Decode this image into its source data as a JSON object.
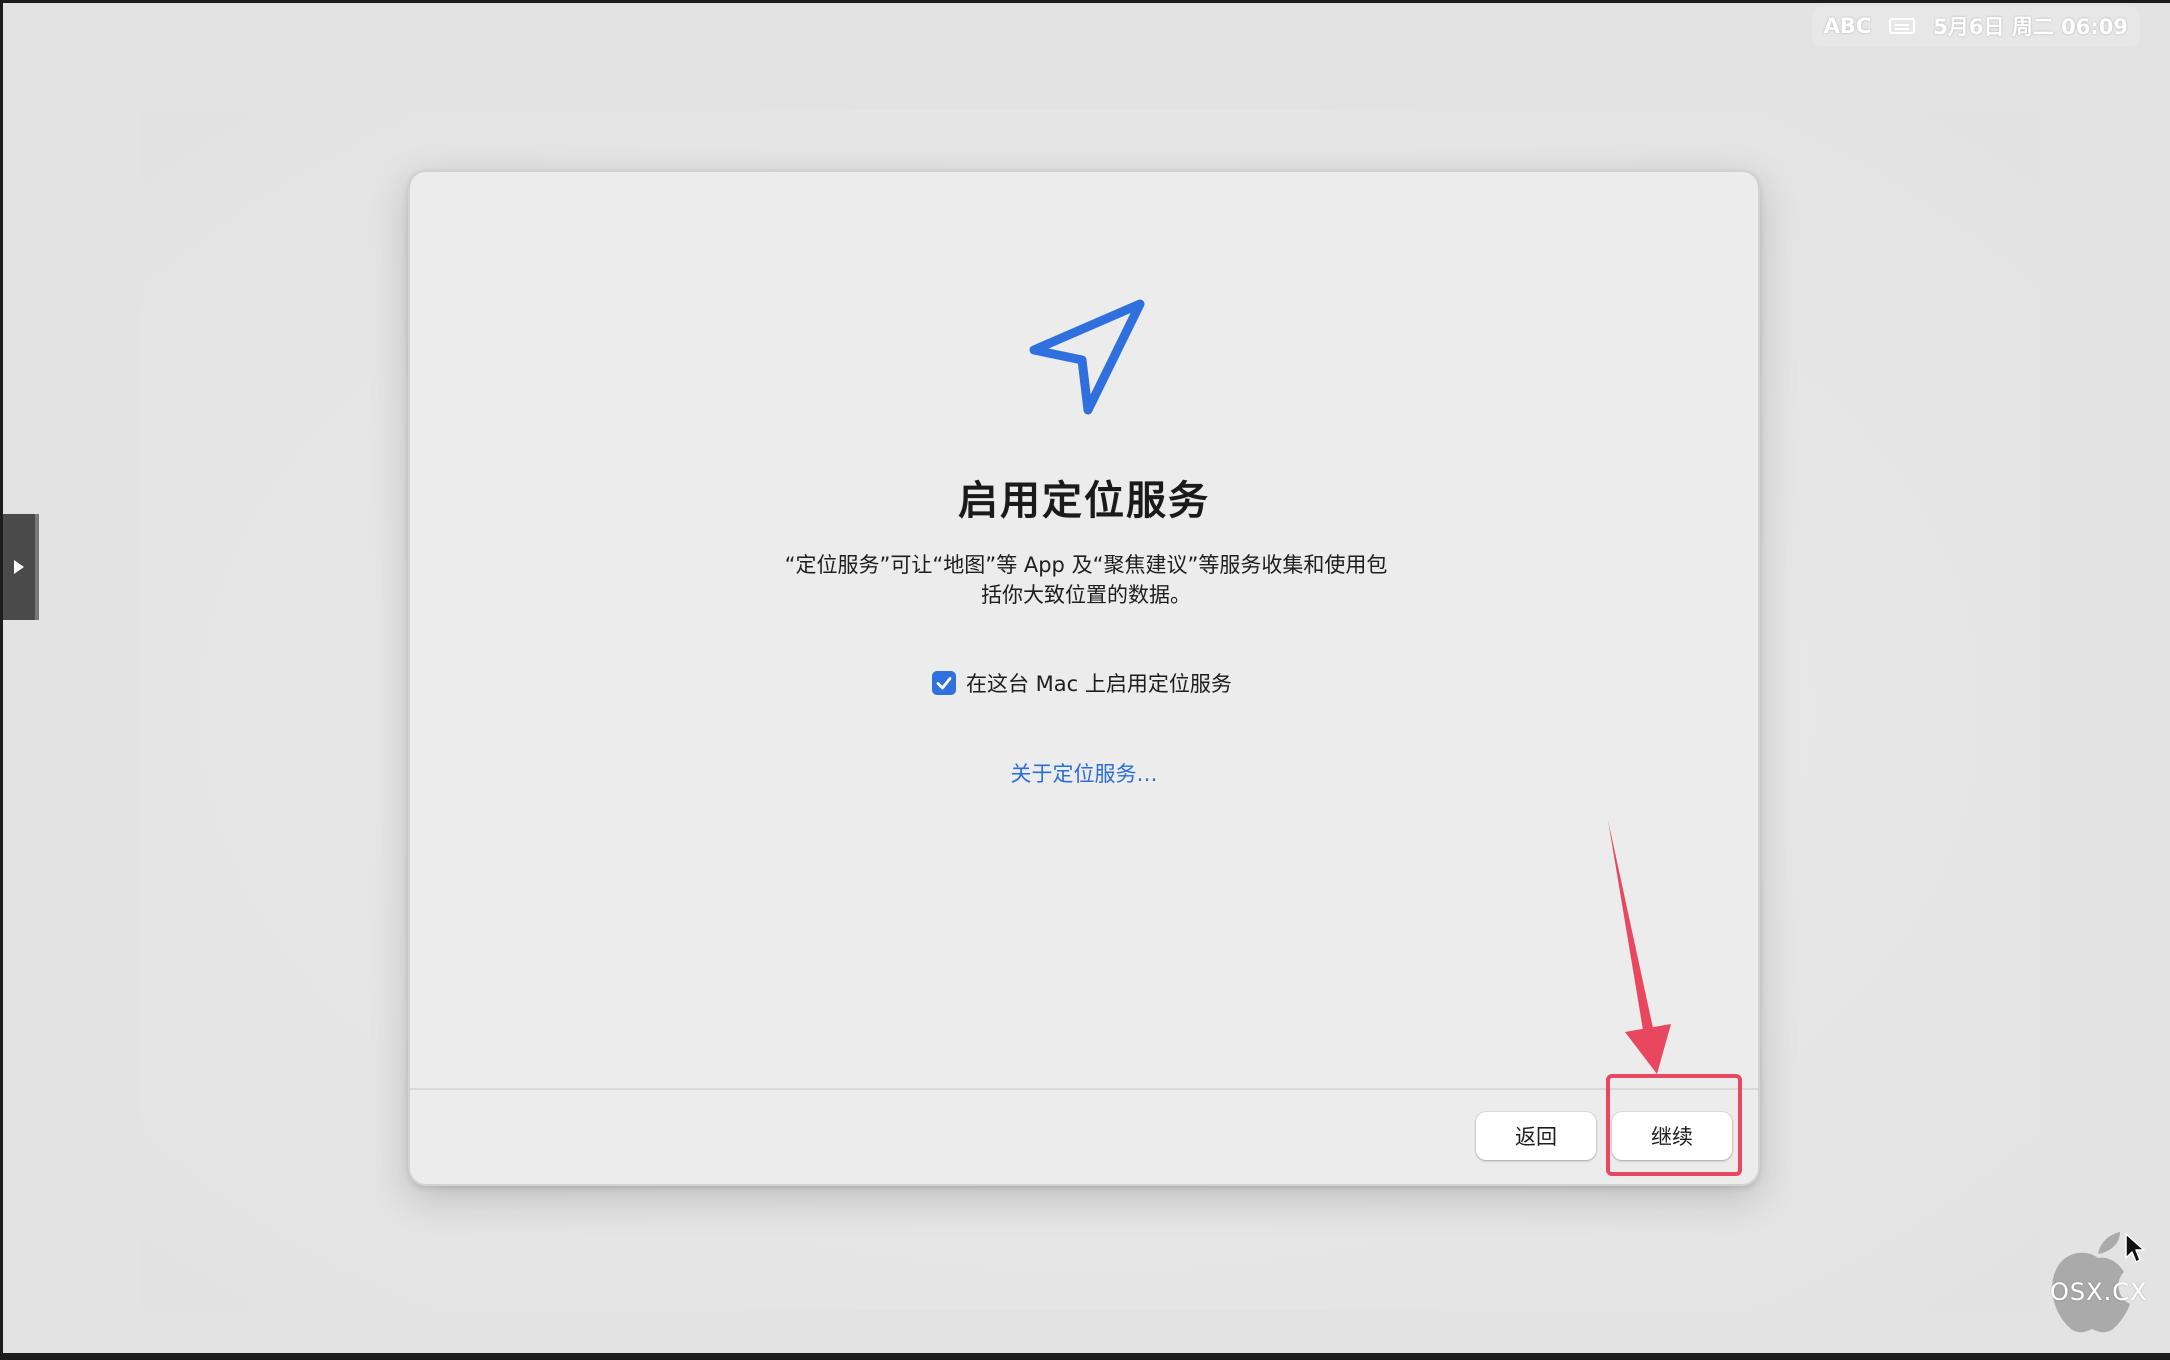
{
  "menubar": {
    "input_source": "ABC",
    "datetime": "5月6日 周二 06:09"
  },
  "dialog": {
    "icon": "location-arrow-icon",
    "title": "启用定位服务",
    "description_line1": "“定位服务”可让“地图”等 App 及“聚焦建议”等服务收集和使用包",
    "description_line2": "括你大致位置的数据。",
    "checkbox": {
      "label": "在这台 Mac 上启用定位服务",
      "checked": true
    },
    "about_link": "关于定位服务…",
    "buttons": {
      "back": "返回",
      "continue": "继续"
    }
  },
  "watermark": {
    "text": "OSX.CX"
  },
  "colors": {
    "accent": "#2f6fde",
    "link": "#2a6ed8",
    "highlight": "#e8475f"
  }
}
